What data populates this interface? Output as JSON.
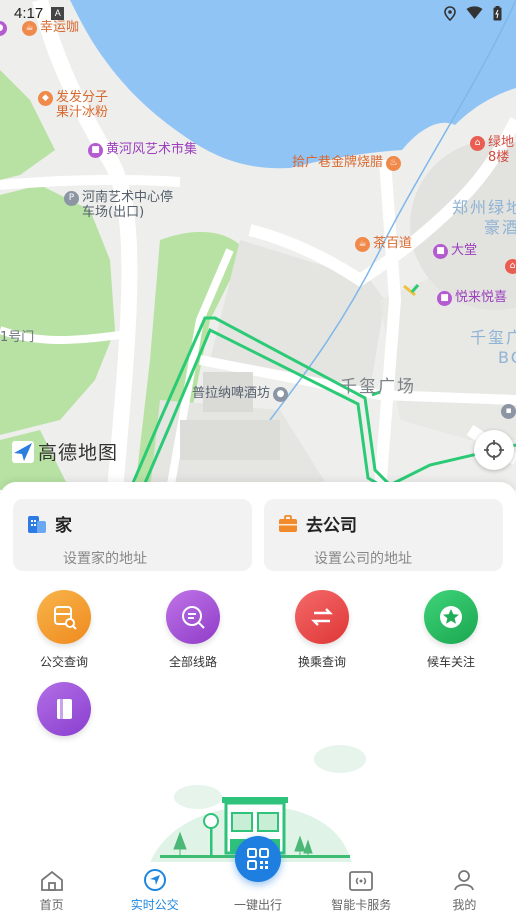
{
  "status_bar": {
    "time": "4:17"
  },
  "map": {
    "pois": {
      "xingyunka": "幸运咖",
      "fafa_line1": "发发分子",
      "fafa_line2": "果汁冰粉",
      "huanghe": "黄河风艺术市集",
      "parking_line1": "河南艺术中心停",
      "parking_line2": "车场(出口)",
      "shaola": "拾广巷金牌烧腊",
      "lvdi_line1": "绿地",
      "lvdi_line2": "8楼",
      "chabaidao": "茶百道",
      "datang": "大堂",
      "yuelai": "悦来悦喜",
      "pulana": "普拉纳啤酒坊"
    },
    "labels": {
      "gate": "1号门",
      "qianxi_plaza": "千玺广场",
      "zhengzhou_line1": "郑州绿地",
      "zhengzhou_line2": "豪酒",
      "qianxi_right_line1": "千玺广",
      "qianxi_right_line2": "BC"
    },
    "logo_text": "高德地图",
    "colors": {
      "water": "#8fc4f5",
      "green": "#b8e2a4",
      "route": "#2bcb76"
    }
  },
  "panel": {
    "home": {
      "title": "家",
      "subtitle": "设置家的地址"
    },
    "work": {
      "title": "去公司",
      "subtitle": "设置公司的地址"
    },
    "grid": [
      {
        "label": "公交查询",
        "icon": "bus-search-icon",
        "color": "#f59a2c"
      },
      {
        "label": "全部线路",
        "icon": "route-list-icon",
        "color": "#a14fd4"
      },
      {
        "label": "换乘查询",
        "icon": "transfer-icon",
        "color": "#ea4b4b"
      },
      {
        "label": "候车关注",
        "icon": "star-icon",
        "color": "#25b85e"
      },
      {
        "label": "",
        "icon": "card-icon",
        "color": "#9b4fd6"
      }
    ]
  },
  "tab_bar": {
    "tabs": [
      {
        "label": "首页",
        "icon": "home-icon"
      },
      {
        "label": "实时公交",
        "icon": "realtime-bus-icon"
      },
      {
        "label": "一键出行",
        "icon": "qr-code-icon"
      },
      {
        "label": "智能卡服务",
        "icon": "smart-card-icon"
      },
      {
        "label": "我的",
        "icon": "user-icon"
      }
    ],
    "active_index": 1,
    "accent": "#1f86e0"
  }
}
